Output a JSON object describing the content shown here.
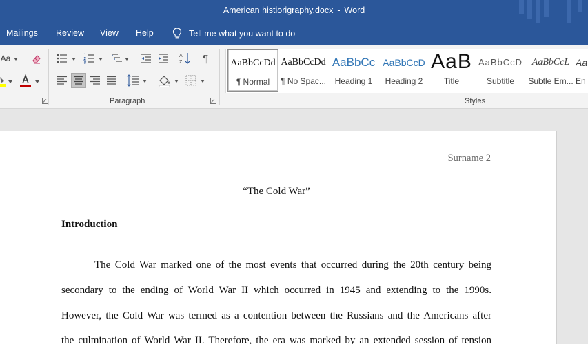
{
  "window": {
    "filename": "American histiorigraphy.docx",
    "separator": "-",
    "app_name": "Word"
  },
  "menu": {
    "tabs": [
      "Mailings",
      "Review",
      "View",
      "Help"
    ],
    "tell_me": "Tell me what you want to do"
  },
  "ribbon": {
    "font_group": {
      "change_case_label": "Aa",
      "font_color": "#c00000",
      "highlight_color": "#ffff00"
    },
    "paragraph_group": {
      "label": "Paragraph"
    },
    "styles_group": {
      "label": "Styles",
      "items": [
        {
          "sample": "AaBbCcDd",
          "name": "¶ Normal"
        },
        {
          "sample": "AaBbCcDd",
          "name": "¶ No Spac..."
        },
        {
          "sample": "AaBbCc",
          "name": "Heading 1"
        },
        {
          "sample": "AaBbCcD",
          "name": "Heading 2"
        },
        {
          "sample": "AaB",
          "name": "Title"
        },
        {
          "sample": "AaBbCcD",
          "name": "Subtitle"
        },
        {
          "sample": "AaBbCcL",
          "name": "Subtle Em..."
        },
        {
          "sample": "Aa",
          "name": "En"
        }
      ]
    }
  },
  "document": {
    "header": "Surname 2",
    "title": "“The Cold War”",
    "heading": "Introduction",
    "paragraph_lines": [
      "The Cold War marked one of the most events that occurred during the 20th century being",
      "secondary to the ending of World War II which occurred in 1945 and extending to the 1990s.",
      "However, the Cold War was termed as a contention between the Russians and the Americans after",
      "the culmination of World War II. Therefore, the era was marked by an extended session of tension"
    ]
  },
  "colors": {
    "title_bar": "#2b579a",
    "ribbon_bg": "#f3f3f3",
    "heading_blue": "#2e74b5"
  }
}
